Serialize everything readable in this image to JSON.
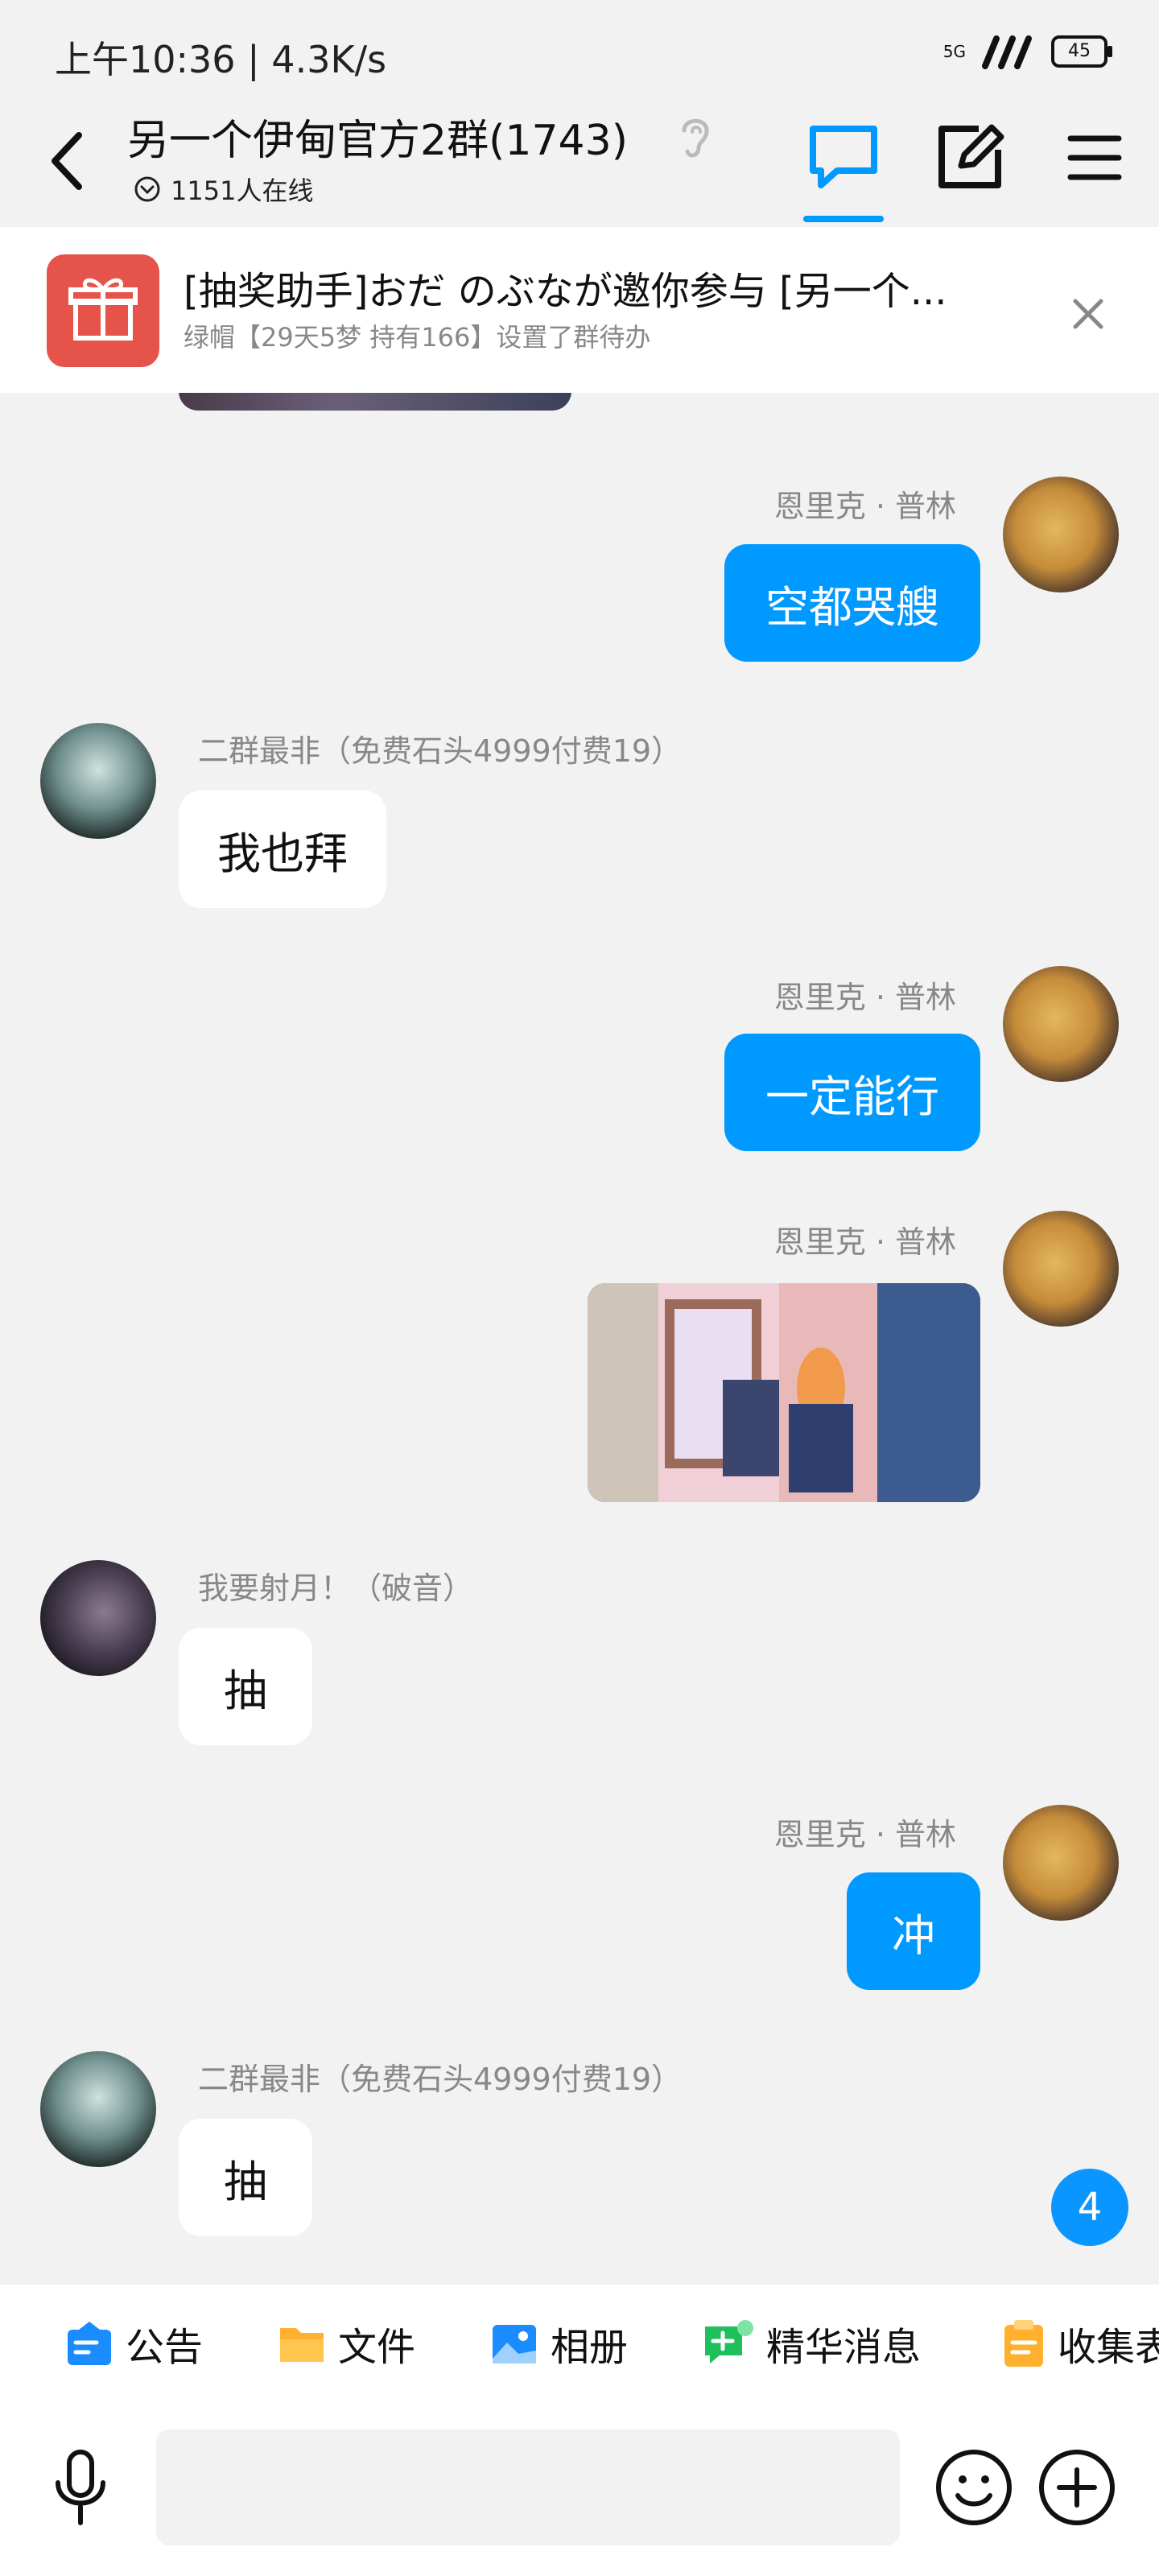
{
  "status_bar": {
    "time_speed": "上午10:36 | 4.3K/s",
    "network": "5G",
    "battery": "45"
  },
  "header": {
    "title": "另一个伊甸官方2群(1743)",
    "online": "1151人在线"
  },
  "pinned": {
    "title": "[抽奖助手]おだ のぶなが邀你参与 [另一个...",
    "subtitle": "绿帽【29天5梦 持有166】设置了群待办"
  },
  "messages": [
    {
      "side": "out",
      "sender": "恩里克 · 普林",
      "text": "空都哭艘"
    },
    {
      "side": "in",
      "sender": "二群最非（免费石头4999付费19）",
      "text": "我也拜"
    },
    {
      "side": "out",
      "sender": "恩里克 · 普林",
      "text": "一定能行"
    },
    {
      "side": "out",
      "sender": "恩里克 · 普林",
      "image": "anime-image"
    },
    {
      "side": "in",
      "sender": "我要射月！（破音）",
      "text": "抽"
    },
    {
      "side": "out",
      "sender": "恩里克 · 普林",
      "text": "冲"
    },
    {
      "side": "in",
      "sender": "二群最非（免费石头4999付费19）",
      "text": "抽"
    }
  ],
  "unread_count": "4",
  "features": [
    {
      "label": "公告",
      "icon": "announcement-icon"
    },
    {
      "label": "文件",
      "icon": "folder-icon"
    },
    {
      "label": "相册",
      "icon": "album-icon"
    },
    {
      "label": "精华消息",
      "icon": "essence-icon"
    },
    {
      "label": "收集表",
      "icon": "clipboard-icon"
    }
  ],
  "input": {
    "placeholder": ""
  },
  "colors": {
    "accent": "#0099ff",
    "gift": "#e6534b",
    "background": "#f2f2f2"
  }
}
